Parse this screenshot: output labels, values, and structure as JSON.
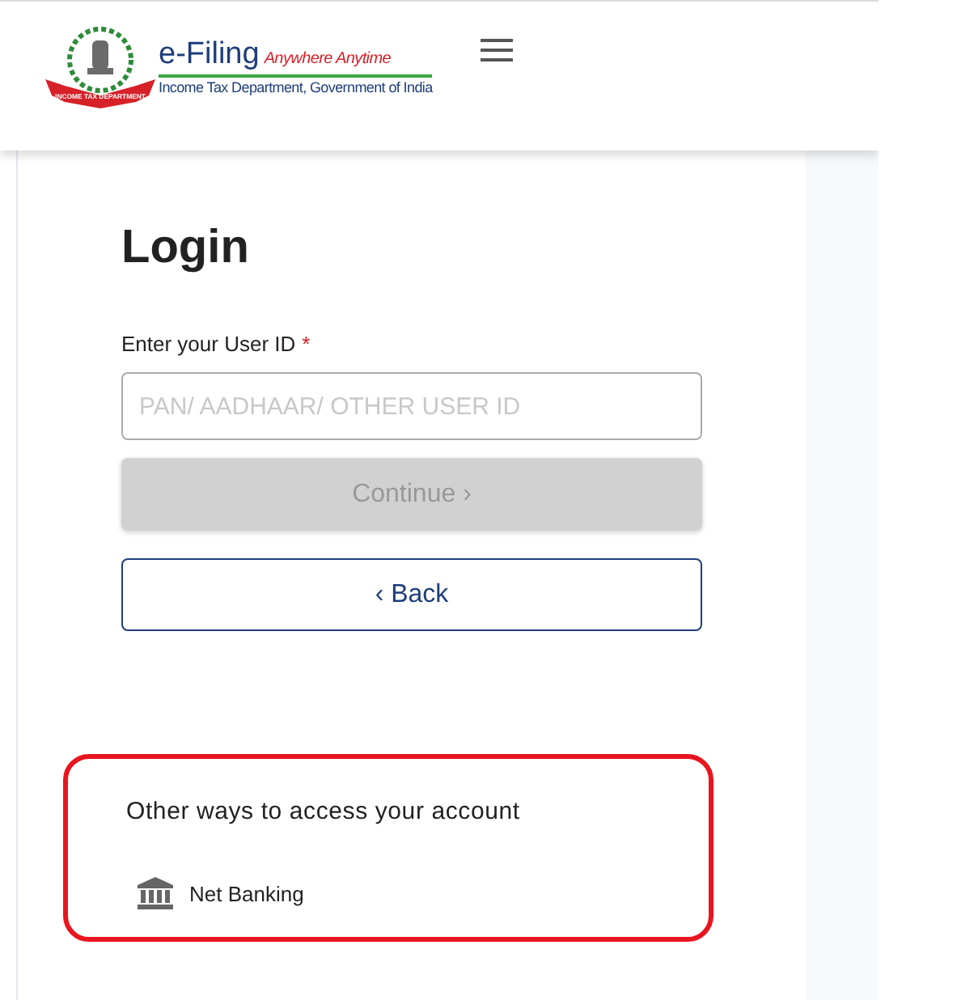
{
  "header": {
    "brand": "e-Filing",
    "tagline": "Anywhere Anytime",
    "subtitle": "Income Tax Department, Government of India",
    "emblem_ribbon": "INCOME TAX DEPARTMENT"
  },
  "login": {
    "title": "Login",
    "field_label": "Enter your User ID",
    "required_mark": "*",
    "placeholder": "PAN/ AADHAAR/ OTHER USER ID",
    "buttons": [
      {
        "label": "Continue",
        "icon": "›",
        "kind": "primary",
        "disabled": true
      },
      {
        "label": "Back",
        "icon": "‹",
        "kind": "outline",
        "disabled": false
      }
    ]
  },
  "other_ways": {
    "title": "Other ways to access your account",
    "highlighted": true,
    "options": [
      {
        "label": "Net Banking"
      }
    ]
  }
}
